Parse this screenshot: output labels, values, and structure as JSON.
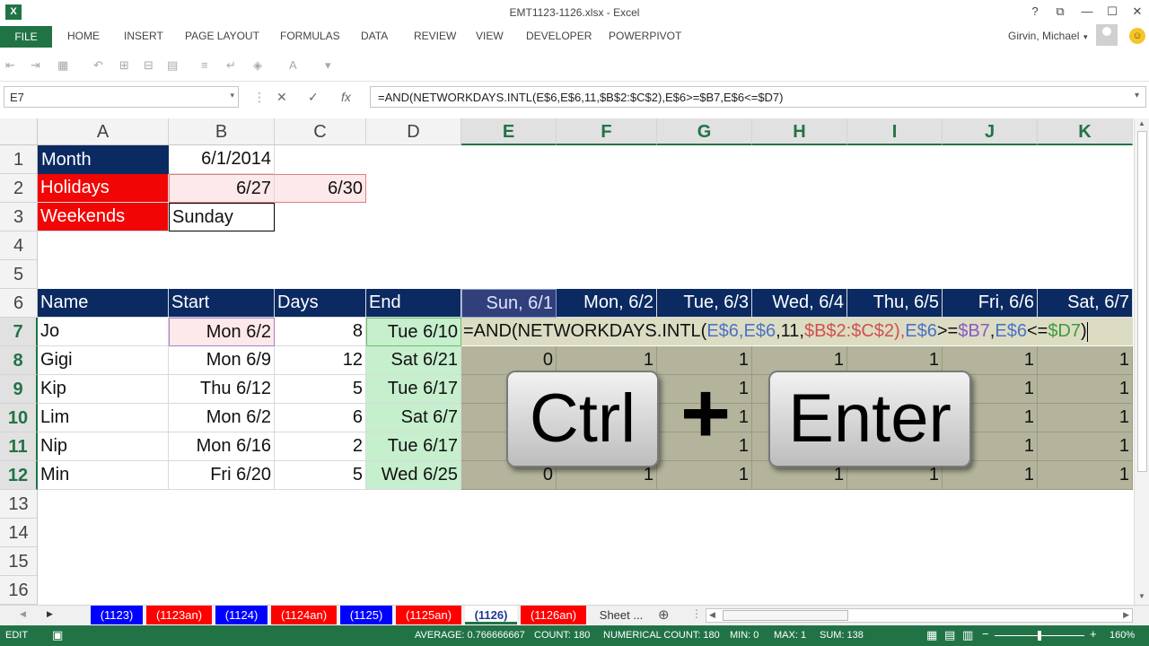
{
  "window": {
    "title": "EMT1123-1126.xlsx - Excel",
    "app_logo": "X",
    "help": "?",
    "restore": "⧉",
    "minimize": "—",
    "maximize": "☐",
    "close": "✕"
  },
  "ribbon": {
    "file": "FILE",
    "tabs": [
      "HOME",
      "INSERT",
      "PAGE LAYOUT",
      "FORMULAS",
      "DATA",
      "REVIEW",
      "VIEW",
      "DEVELOPER",
      "POWERPIVOT"
    ],
    "user": "Girvin, Michael"
  },
  "formula_bar": {
    "name_box": "E7",
    "cancel": "✕",
    "enter": "✓",
    "fx": "fx",
    "formula": "=AND(NETWORKDAYS.INTL(E$6,E$6,11,$B$2:$C$2),E$6>=$B7,E$6<=$D7)"
  },
  "columns": [
    "A",
    "B",
    "C",
    "D",
    "E",
    "F",
    "G",
    "H",
    "I",
    "J",
    "K"
  ],
  "rows": [
    "1",
    "2",
    "3",
    "4",
    "5",
    "6",
    "7",
    "8",
    "9",
    "10",
    "11",
    "12",
    "13",
    "14",
    "15",
    "16"
  ],
  "params": {
    "month_label": "Month",
    "month_value": "6/1/2014",
    "holidays_label": "Holidays",
    "holiday1": "6/27",
    "holiday2": "6/30",
    "weekends_label": "Weekends",
    "weekends_value": "Sunday"
  },
  "table": {
    "headers": [
      "Name",
      "Start",
      "Days",
      "End"
    ],
    "date_headers": [
      "Sun, 6/1",
      "Mon, 6/2",
      "Tue, 6/3",
      "Wed, 6/4",
      "Thu, 6/5",
      "Fri, 6/6",
      "Sat, 6/7"
    ],
    "rows": [
      {
        "name": "Jo",
        "start": "Mon 6/2",
        "days": "8",
        "end": "Tue 6/10"
      },
      {
        "name": "Gigi",
        "start": "Mon 6/9",
        "days": "12",
        "end": "Sat 6/21"
      },
      {
        "name": "Kip",
        "start": "Thu 6/12",
        "days": "5",
        "end": "Tue 6/17"
      },
      {
        "name": "Lim",
        "start": "Mon 6/2",
        "days": "6",
        "end": "Sat 6/7"
      },
      {
        "name": "Nip",
        "start": "Mon 6/16",
        "days": "2",
        "end": "Tue 6/17"
      },
      {
        "name": "Min",
        "start": "Fri 6/20",
        "days": "5",
        "end": "Wed 6/25"
      }
    ],
    "result_rows": [
      [
        "0",
        "1",
        "1",
        "1",
        "1",
        "1",
        "1"
      ],
      [
        "",
        "",
        "1",
        "",
        "",
        "1",
        "1"
      ],
      [
        "",
        "",
        "1",
        "",
        "",
        "1",
        "1"
      ],
      [
        "",
        "",
        "1",
        "",
        "",
        "1",
        "1"
      ],
      [
        "0",
        "1",
        "1",
        "1",
        "1",
        "1",
        "1"
      ]
    ]
  },
  "edit_formula_parts": [
    "=AND(NETWORKDAYS.INTL(",
    "E$6",
    ",",
    "E$6",
    ",11,",
    "$B$2:$C$2",
    "),",
    "E$6",
    ">=",
    "$B7",
    ",",
    "E$6",
    "<=",
    "$D7",
    ")"
  ],
  "overlay": {
    "key1": "Ctrl",
    "plus": "+",
    "key2": "Enter"
  },
  "sheet_tabs": [
    {
      "label": "(1123)",
      "style": "blue"
    },
    {
      "label": "(1123an)",
      "style": "red"
    },
    {
      "label": "(1124)",
      "style": "blue"
    },
    {
      "label": "(1124an)",
      "style": "red"
    },
    {
      "label": "(1125)",
      "style": "blue"
    },
    {
      "label": "(1125an)",
      "style": "red"
    },
    {
      "label": "(1126)",
      "style": "active"
    },
    {
      "label": "(1126an)",
      "style": "red"
    },
    {
      "label": "Sheet ...",
      "style": "plain"
    }
  ],
  "status": {
    "mode": "EDIT",
    "average": "AVERAGE: 0.766666667",
    "count": "COUNT: 180",
    "numerical_count": "NUMERICAL COUNT: 180",
    "min": "MIN: 0",
    "max": "MAX: 1",
    "sum": "SUM: 138",
    "zoom": "160%"
  },
  "colors": {
    "excel_green": "#217346",
    "navy": "#0b2a62",
    "red": "#f20505"
  }
}
